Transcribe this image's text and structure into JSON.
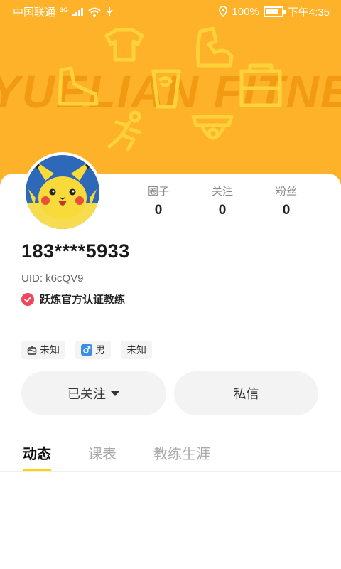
{
  "status_bar": {
    "carrier": "中国联通",
    "network": "3G",
    "battery": "100%",
    "time": "下午4:35"
  },
  "hero": {
    "watermark": "YUELIAN FITNESS",
    "background_color": "#FDB22A"
  },
  "profile": {
    "stats": [
      {
        "label": "圈子",
        "value": "0"
      },
      {
        "label": "关注",
        "value": "0"
      },
      {
        "label": "粉丝",
        "value": "0"
      }
    ],
    "username": "183****5933",
    "uid": "UID: k6cQV9",
    "certification": "跃炼官方认证教练",
    "tags": [
      {
        "icon": "cake-icon",
        "label": "未知"
      },
      {
        "icon": "male-icon",
        "label": "男"
      },
      {
        "icon": "",
        "label": "未知"
      }
    ]
  },
  "actions": {
    "follow_label": "已关注",
    "message_label": "私信"
  },
  "tabs": [
    {
      "label": "动态",
      "active": true
    },
    {
      "label": "课表",
      "active": false
    },
    {
      "label": "教练生涯",
      "active": false
    }
  ],
  "colors": {
    "accent": "#FFD100",
    "cert": "#F2445A",
    "male": "#3A8EE6"
  }
}
